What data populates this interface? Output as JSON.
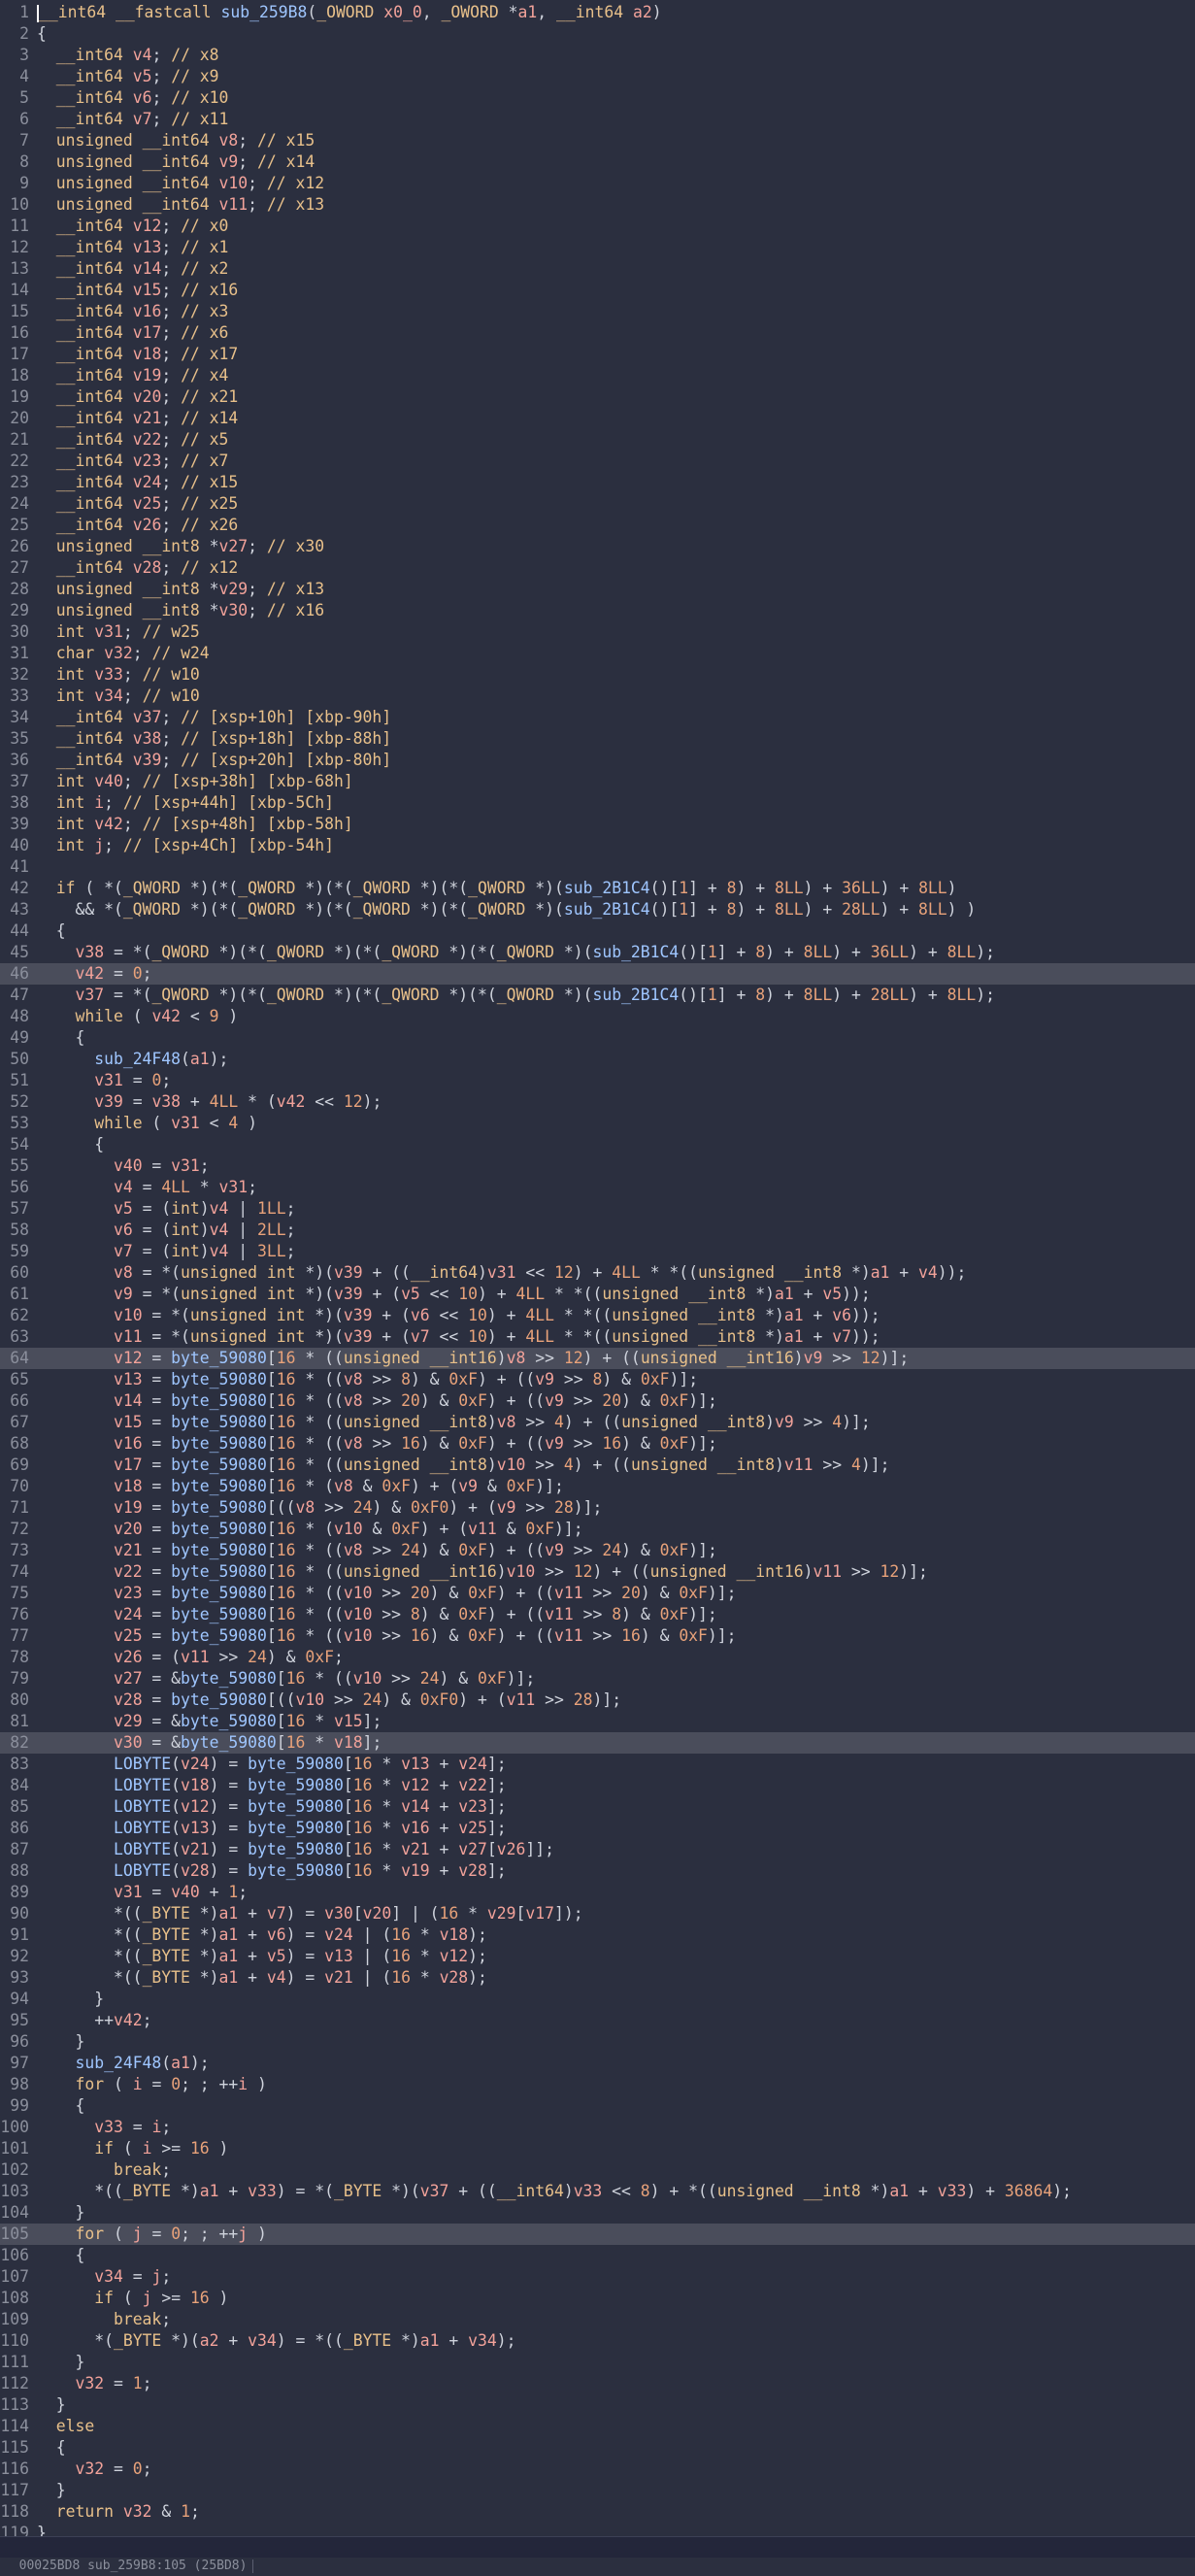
{
  "editor": {
    "lines": [
      "__int64 __fastcall sub_259B8(_OWORD x0_0, _OWORD *a1, __int64 a2)",
      "{",
      "  __int64 v4; // x8",
      "  __int64 v5; // x9",
      "  __int64 v6; // x10",
      "  __int64 v7; // x11",
      "  unsigned __int64 v8; // x15",
      "  unsigned __int64 v9; // x14",
      "  unsigned __int64 v10; // x12",
      "  unsigned __int64 v11; // x13",
      "  __int64 v12; // x0",
      "  __int64 v13; // x1",
      "  __int64 v14; // x2",
      "  __int64 v15; // x16",
      "  __int64 v16; // x3",
      "  __int64 v17; // x6",
      "  __int64 v18; // x17",
      "  __int64 v19; // x4",
      "  __int64 v20; // x21",
      "  __int64 v21; // x14",
      "  __int64 v22; // x5",
      "  __int64 v23; // x7",
      "  __int64 v24; // x15",
      "  __int64 v25; // x25",
      "  __int64 v26; // x26",
      "  unsigned __int8 *v27; // x30",
      "  __int64 v28; // x12",
      "  unsigned __int8 *v29; // x13",
      "  unsigned __int8 *v30; // x16",
      "  int v31; // w25",
      "  char v32; // w24",
      "  int v33; // w10",
      "  int v34; // w10",
      "  __int64 v37; // [xsp+10h] [xbp-90h]",
      "  __int64 v38; // [xsp+18h] [xbp-88h]",
      "  __int64 v39; // [xsp+20h] [xbp-80h]",
      "  int v40; // [xsp+38h] [xbp-68h]",
      "  int i; // [xsp+44h] [xbp-5Ch]",
      "  int v42; // [xsp+48h] [xbp-58h]",
      "  int j; // [xsp+4Ch] [xbp-54h]",
      "",
      "  if ( *(_QWORD *)(*(_QWORD *)(*(_QWORD *)(*(_QWORD *)(sub_2B1C4()[1] + 8) + 8LL) + 36LL) + 8LL)",
      "    && *(_QWORD *)(*(_QWORD *)(*(_QWORD *)(*(_QWORD *)(sub_2B1C4()[1] + 8) + 8LL) + 28LL) + 8LL) )",
      "  {",
      "    v38 = *(_QWORD *)(*(_QWORD *)(*(_QWORD *)(*(_QWORD *)(sub_2B1C4()[1] + 8) + 8LL) + 36LL) + 8LL);",
      "    v42 = 0;",
      "    v37 = *(_QWORD *)(*(_QWORD *)(*(_QWORD *)(*(_QWORD *)(sub_2B1C4()[1] + 8) + 8LL) + 28LL) + 8LL);",
      "    while ( v42 < 9 )",
      "    {",
      "      sub_24F48(a1);",
      "      v31 = 0;",
      "      v39 = v38 + 4LL * (v42 << 12);",
      "      while ( v31 < 4 )",
      "      {",
      "        v40 = v31;",
      "        v4 = 4LL * v31;",
      "        v5 = (int)v4 | 1LL;",
      "        v6 = (int)v4 | 2LL;",
      "        v7 = (int)v4 | 3LL;",
      "        v8 = *(unsigned int *)(v39 + ((__int64)v31 << 12) + 4LL * *((unsigned __int8 *)a1 + v4));",
      "        v9 = *(unsigned int *)(v39 + (v5 << 10) + 4LL * *((unsigned __int8 *)a1 + v5));",
      "        v10 = *(unsigned int *)(v39 + (v6 << 10) + 4LL * *((unsigned __int8 *)a1 + v6));",
      "        v11 = *(unsigned int *)(v39 + (v7 << 10) + 4LL * *((unsigned __int8 *)a1 + v7));",
      "        v12 = byte_59080[16 * ((unsigned __int16)v8 >> 12) + ((unsigned __int16)v9 >> 12)];",
      "        v13 = byte_59080[16 * ((v8 >> 8) & 0xF) + ((v9 >> 8) & 0xF)];",
      "        v14 = byte_59080[16 * ((v8 >> 20) & 0xF) + ((v9 >> 20) & 0xF)];",
      "        v15 = byte_59080[16 * ((unsigned __int8)v8 >> 4) + ((unsigned __int8)v9 >> 4)];",
      "        v16 = byte_59080[16 * ((v8 >> 16) & 0xF) + ((v9 >> 16) & 0xF)];",
      "        v17 = byte_59080[16 * ((unsigned __int8)v10 >> 4) + ((unsigned __int8)v11 >> 4)];",
      "        v18 = byte_59080[16 * (v8 & 0xF) + (v9 & 0xF)];",
      "        v19 = byte_59080[((v8 >> 24) & 0xF0) + (v9 >> 28)];",
      "        v20 = byte_59080[16 * (v10 & 0xF) + (v11 & 0xF)];",
      "        v21 = byte_59080[16 * ((v8 >> 24) & 0xF) + ((v9 >> 24) & 0xF)];",
      "        v22 = byte_59080[16 * ((unsigned __int16)v10 >> 12) + ((unsigned __int16)v11 >> 12)];",
      "        v23 = byte_59080[16 * ((v10 >> 20) & 0xF) + ((v11 >> 20) & 0xF)];",
      "        v24 = byte_59080[16 * ((v10 >> 8) & 0xF) + ((v11 >> 8) & 0xF)];",
      "        v25 = byte_59080[16 * ((v10 >> 16) & 0xF) + ((v11 >> 16) & 0xF)];",
      "        v26 = (v11 >> 24) & 0xF;",
      "        v27 = &byte_59080[16 * ((v10 >> 24) & 0xF)];",
      "        v28 = byte_59080[((v10 >> 24) & 0xF0) + (v11 >> 28)];",
      "        v29 = &byte_59080[16 * v15];",
      "        v30 = &byte_59080[16 * v18];",
      "        LOBYTE(v24) = byte_59080[16 * v13 + v24];",
      "        LOBYTE(v18) = byte_59080[16 * v12 + v22];",
      "        LOBYTE(v12) = byte_59080[16 * v14 + v23];",
      "        LOBYTE(v13) = byte_59080[16 * v16 + v25];",
      "        LOBYTE(v21) = byte_59080[16 * v21 + v27[v26]];",
      "        LOBYTE(v28) = byte_59080[16 * v19 + v28];",
      "        v31 = v40 + 1;",
      "        *((_BYTE *)a1 + v7) = v30[v20] | (16 * v29[v17]);",
      "        *((_BYTE *)a1 + v6) = v24 | (16 * v18);",
      "        *((_BYTE *)a1 + v5) = v13 | (16 * v12);",
      "        *((_BYTE *)a1 + v4) = v21 | (16 * v28);",
      "      }",
      "      ++v42;",
      "    }",
      "    sub_24F48(a1);",
      "    for ( i = 0; ; ++i )",
      "    {",
      "      v33 = i;",
      "      if ( i >= 16 )",
      "        break;",
      "      *((_BYTE *)a1 + v33) = *(_BYTE *)(v37 + ((__int64)v33 << 8) + *((unsigned __int8 *)a1 + v33) + 36864);",
      "    }",
      "    for ( j = 0; ; ++j )",
      "    {",
      "      v34 = j;",
      "      if ( j >= 16 )",
      "        break;",
      "      *(_BYTE *)(a2 + v34) = *((_BYTE *)a1 + v34);",
      "    }",
      "    v32 = 1;",
      "  }",
      "  else",
      "  {",
      "    v32 = 0;",
      "  }",
      "  return v32 & 1;",
      "}"
    ],
    "highlighted_lines": [
      46,
      64,
      82,
      105
    ],
    "colors": {
      "background": "#2b2f3f",
      "highlight": "#4a4d5b",
      "text": "#cfd3dc",
      "keyword": "#e8c08a",
      "number": "#e8a27a",
      "variable": "#f2a29a",
      "global": "#9fc6ff",
      "line_number": "#8b8f9c"
    }
  },
  "statusbar": {
    "text": "00025BD8 sub_259B8:105 (25BD8)"
  }
}
